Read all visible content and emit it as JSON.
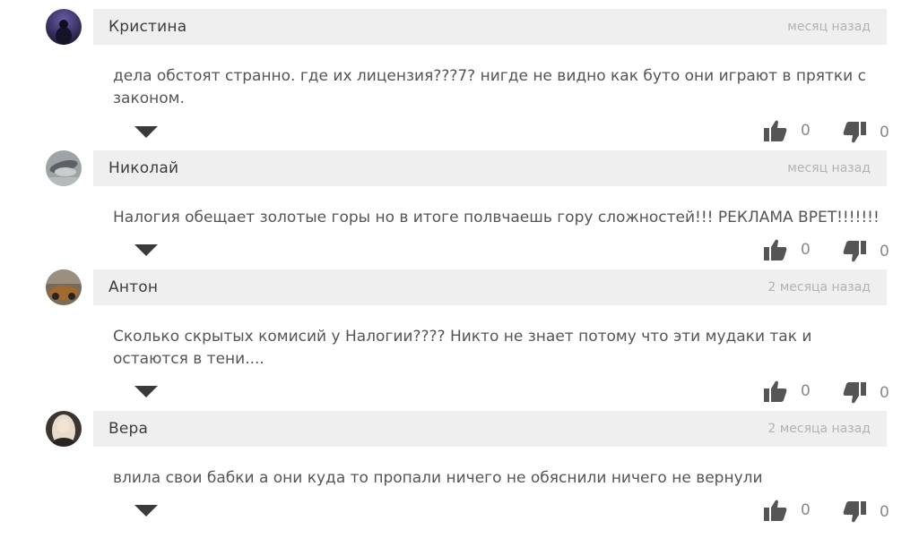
{
  "comments": [
    {
      "author": "Кристина",
      "time": "месяц назад",
      "text": "дела обстоят странно. где их лицензия???7? нигде не видно как буто они играют в прятки с законом.",
      "likes": "0",
      "dislikes": "0",
      "avatar_color": "#3d3a6b"
    },
    {
      "author": "Николай",
      "time": "месяц назад",
      "text": "Налогия обещает золотые горы но в итоге полвчаешь гору сложностей!!! РЕКЛАМА ВРЕТ!!!!!!!",
      "likes": "0",
      "dislikes": "0",
      "avatar_color": "#8b9294"
    },
    {
      "author": "Антон",
      "time": "2 месяца назад",
      "text": "Сколько скрытых комисий у Налогии???? Никто не знает потому что эти мудаки так и остаются в тени....",
      "likes": "0",
      "dislikes": "0",
      "avatar_color": "#6a5a4a"
    },
    {
      "author": "Вера",
      "time": "2 месяца назад",
      "text": "влила свои бабки а они куда то пропали ничего не обяснили ничего не вернули",
      "likes": "0",
      "dislikes": "0",
      "avatar_color": "#c8b9a6"
    }
  ],
  "icons": {
    "expand": "triangle-down-icon",
    "like": "thumbs-up-icon",
    "dislike": "thumbs-down-icon"
  },
  "colors": {
    "header_bg": "#efefef",
    "icon": "#555555",
    "time": "#b3b3b3"
  }
}
